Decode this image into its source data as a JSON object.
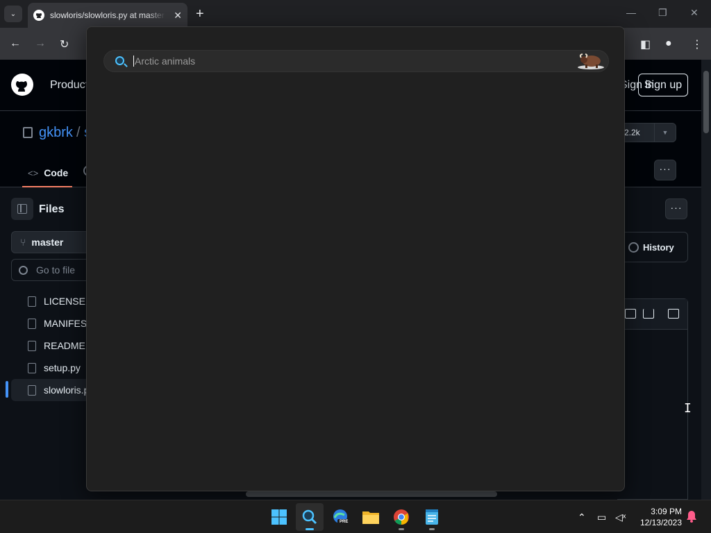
{
  "browser": {
    "tab_title": "slowloris/slowloris.py at master · gkbrk/slowloris",
    "tab_close": "✕",
    "new_tab": "+",
    "tab_list": "⌄",
    "window_controls": {
      "minimize": "—",
      "restore": "❐",
      "close": "✕"
    }
  },
  "github": {
    "header": {
      "product": "Product",
      "sign_in": "Sign in",
      "sign_up": "Sign up"
    },
    "repo": {
      "owner": "gkbrk",
      "slash": "/",
      "name": "slowloris",
      "stars": "2.2k"
    },
    "tabs": {
      "code": "Code"
    },
    "sidebar": {
      "title": "Files",
      "branch": "master",
      "goto_placeholder": "Go to file",
      "files": [
        {
          "name": "LICENSE"
        },
        {
          "name": "MANIFEST.in"
        },
        {
          "name": "README.md"
        },
        {
          "name": "setup.py"
        },
        {
          "name": "slowloris.py"
        }
      ]
    },
    "history_label": "History"
  },
  "search": {
    "placeholder": "Arctic animals",
    "icon": "search-icon",
    "highlight": "musk-ox-illustration"
  },
  "taskbar": {
    "apps": [
      "start",
      "search",
      "edge-preview",
      "file-explorer",
      "chrome",
      "notepad"
    ],
    "edge_badge": "PRE",
    "time": "3:09 PM",
    "date": "12/13/2023"
  },
  "colors": {
    "accent": "#4cc2ff",
    "github_link": "#4493f8",
    "tab_underline": "#f78166"
  }
}
